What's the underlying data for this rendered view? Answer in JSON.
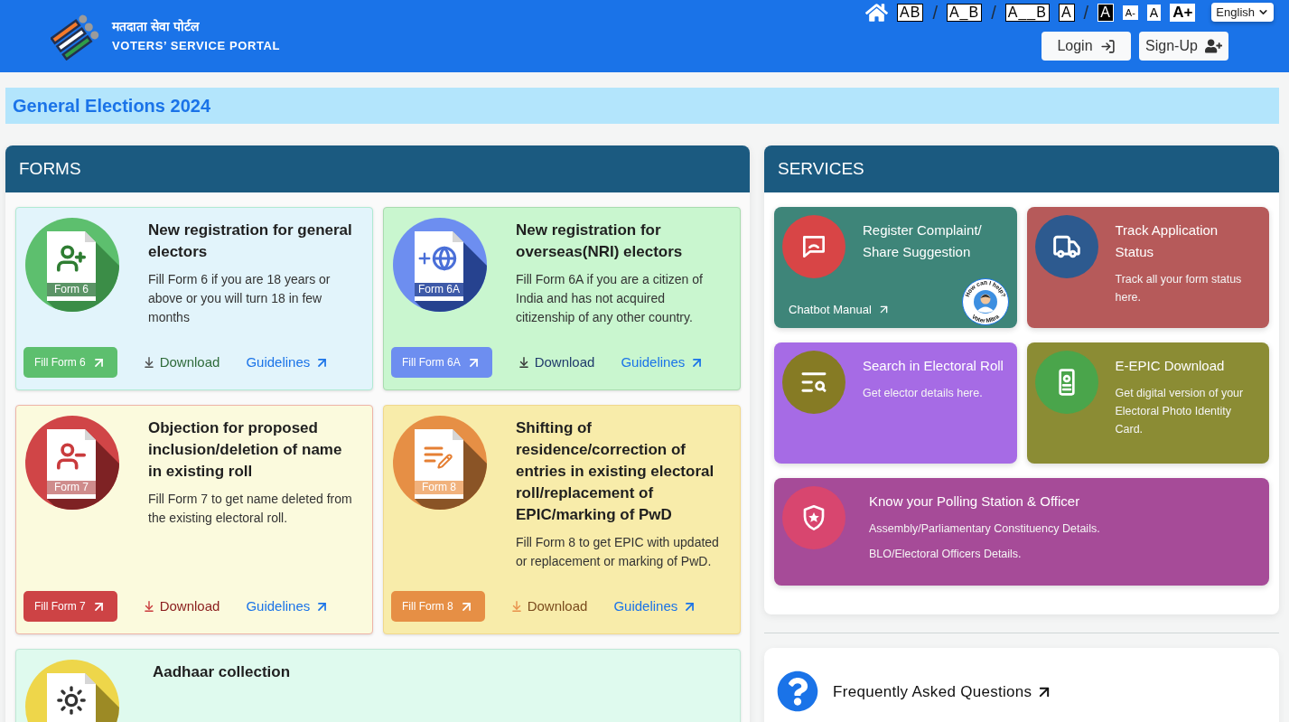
{
  "header": {
    "logo_title": "मतदाता सेवा पोर्टल",
    "logo_subtitle": "VOTERS’ SERVICE PORTAL",
    "text_tools": [
      {
        "label": "AB",
        "kind": "spacing"
      },
      {
        "label": "/",
        "kind": "separator"
      },
      {
        "label": "A_B",
        "kind": "spacing"
      },
      {
        "label": "/",
        "kind": "separator"
      },
      {
        "label": "A__B",
        "kind": "spacing"
      },
      {
        "label": "A",
        "kind": "contrast"
      },
      {
        "label": "/",
        "kind": "separator"
      },
      {
        "label": "A",
        "kind": "inverted"
      },
      {
        "label": "A-",
        "kind": "decrease"
      },
      {
        "label": "A",
        "kind": "reset"
      },
      {
        "label": "A+",
        "kind": "increase"
      }
    ],
    "language": "English",
    "auth_buttons": [
      {
        "label": "Login",
        "kind": "login"
      },
      {
        "label": "Sign-Up",
        "kind": "signup"
      }
    ]
  },
  "banner": {
    "title": "General Elections 2024"
  },
  "forms": {
    "title": "FORMS",
    "cards": [
      {
        "title": "New registration for general electors",
        "description": "Fill Form 6 if you are 18 years or above or you will turn 18 in few months",
        "form_label": "Form 6",
        "fill_button": "Fill Form 6",
        "download": "Download",
        "guidelines": "Guidelines"
      },
      {
        "title": "New registration for overseas(NRI) electors",
        "description": "Fill Form 6A if you are a citizen of India and has not acquired citizenship of any other country.",
        "form_label": "Form 6A",
        "fill_button": "Fill Form 6A",
        "download": "Download",
        "guidelines": "Guidelines"
      },
      {
        "title": "Objection for proposed inclusion/deletion of name in existing roll",
        "description": "Fill Form 7 to get name deleted from the existing electoral roll.",
        "form_label": "Form 7",
        "fill_button": "Fill Form 7",
        "download": "Download",
        "guidelines": "Guidelines"
      },
      {
        "title": "Shifting of residence/correction of entries in existing electoral roll/replacement of EPIC/marking of PwD",
        "description": "Fill Form 8 to get EPIC with updated or replacement or marking of PwD.",
        "form_label": "Form 8",
        "fill_button": "Fill Form 8",
        "download": "Download",
        "guidelines": "Guidelines"
      },
      {
        "title": "Aadhaar collection"
      }
    ]
  },
  "services": {
    "title": "SERVICES",
    "cards": [
      {
        "title": "Register Complaint/ Share Suggestion",
        "link": "Chatbot Manual",
        "badge_top": "How can I help?",
        "badge_bottom": "Voter Mitra"
      },
      {
        "title": "Track Application Status",
        "descriptions": [
          "Track all your form status here."
        ]
      },
      {
        "title": "Search in Electoral Roll",
        "descriptions": [
          "Get elector details here."
        ]
      },
      {
        "title": "E-EPIC Download",
        "descriptions": [
          "Get digital version of your Electoral Photo Identity Card."
        ]
      },
      {
        "title": "Know your Polling Station & Officer",
        "descriptions": [
          "Assembly/Parliamentary Constituency Details.",
          "BLO/Electoral Officers Details."
        ]
      }
    ]
  },
  "faq": {
    "title": "Frequently Asked Questions"
  }
}
